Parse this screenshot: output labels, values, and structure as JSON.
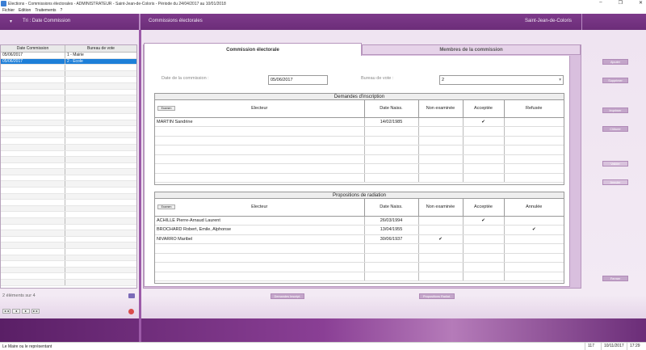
{
  "window": {
    "title": "Elections - Commissions électorales - ADMINISTRATEUR - Saint-Jean-de-Coloris - Période du 24/04/2017 au 10/01/2018",
    "controls": [
      "–",
      "❐",
      "✕"
    ]
  },
  "menu": [
    "Fichier",
    "Edition",
    "Traitements",
    "?"
  ],
  "header": {
    "sort_arrow": "▾",
    "sort_label": "Tri : Date Commission",
    "section_title": "Commissions électorales",
    "city": "Saint-Jean-de-Coloris"
  },
  "left_list": {
    "columns": [
      "Date Commission",
      "Bureau de vote"
    ],
    "rows": [
      {
        "date": "05/06/2017",
        "bureau": "1 - Mairie",
        "selected": false
      },
      {
        "date": "05/06/2017",
        "bureau": "2 - Ecole",
        "selected": true
      }
    ],
    "count_text": "2 éléments sur 4",
    "small_buttons": [
      "◄◄",
      "◄",
      "►",
      "►►"
    ]
  },
  "tabs": {
    "active": "Commission électorale",
    "inactive": "Membres de la commission"
  },
  "form": {
    "date_label": "Date de la commission :",
    "date_value": "05/06/2017",
    "bureau_label": "Bureau de vote :",
    "bureau_value": "2"
  },
  "inscription": {
    "title": "Demandes d'inscription",
    "exam_button": "Examen",
    "headers": [
      "Electeur",
      "Date Naiss.",
      "Non examinée",
      "Acceptée",
      "Refusée"
    ],
    "rows": [
      {
        "electeur": "MARTIN Sandrine",
        "date": "14/02/1985",
        "non_examinee": "",
        "acceptee": "✔",
        "refusee": ""
      }
    ]
  },
  "radiation": {
    "title": "Propositions de radiation",
    "exam_button": "Examen",
    "headers": [
      "Electeur",
      "Date Naiss.",
      "Non examinée",
      "Acceptée",
      "Annulée"
    ],
    "rows": [
      {
        "electeur": "ACHILLE Pierre-Arnaud Laurent",
        "date": "26/03/1994",
        "non_examinee": "",
        "acceptee": "✔",
        "annulee": ""
      },
      {
        "electeur": "BROCHARD Robert, Emile, Alphonse",
        "date": "13/04/1955",
        "non_examinee": "",
        "acceptee": "",
        "annulee": "✔"
      },
      {
        "electeur": "NIVARRO Maribel",
        "date": "30/06/1937",
        "non_examinee": "✔",
        "acceptee": "",
        "annulee": ""
      }
    ]
  },
  "right_buttons": {
    "ajouter": "Ajouter",
    "supprimer": "Supprimer",
    "imprimer": "Imprimer",
    "cloturer": "Clôturer",
    "valider": "Valider",
    "annuler": "Annuler",
    "fermer": "Fermer"
  },
  "bottom_buttons": {
    "inscriptions": "Demandes Inscript.",
    "radiations": "Propositions Radiat."
  },
  "status": {
    "message": "Le Maire ou le représentant",
    "count": "117",
    "date": "10/11/2017",
    "time": "17:29"
  },
  "colors": {
    "header": "#6c2d79",
    "selection": "#1e7fd8",
    "panel": "#d9bfde"
  }
}
